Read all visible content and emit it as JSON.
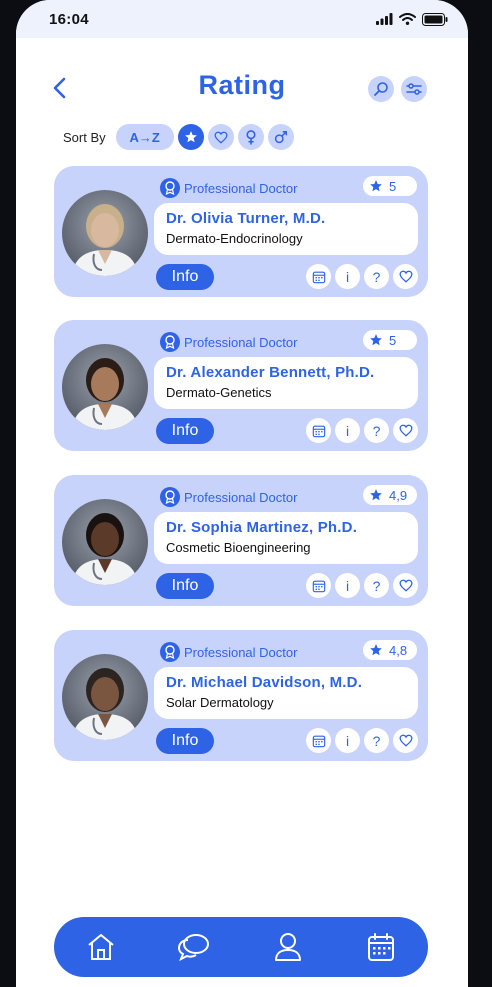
{
  "status": {
    "time": "16:04"
  },
  "header": {
    "title": "Rating"
  },
  "sort": {
    "label": "Sort By",
    "options": [
      {
        "label": "A→Z",
        "icon": "alphabetical-icon"
      },
      {
        "label": "",
        "icon": "star-icon",
        "active": true
      },
      {
        "label": "",
        "icon": "heart-icon"
      },
      {
        "label": "",
        "icon": "female-icon"
      },
      {
        "label": "",
        "icon": "male-icon"
      }
    ]
  },
  "doctors": [
    {
      "badge": "Professional Doctor",
      "rating": "5",
      "name": "Dr. Olivia Turner, M.D.",
      "specialty": "Dermato-Endocrinology",
      "info_label": "Info"
    },
    {
      "badge": "Professional Doctor",
      "rating": "5",
      "name": "Dr. Alexander Bennett, Ph.D.",
      "specialty": "Dermato-Genetics",
      "info_label": "Info"
    },
    {
      "badge": "Professional Doctor",
      "rating": "4,9",
      "name": "Dr. Sophia Martinez, Ph.D.",
      "specialty": "Cosmetic Bioengineering",
      "info_label": "Info"
    },
    {
      "badge": "Professional Doctor",
      "rating": "4,8",
      "name": "Dr. Michael Davidson, M.D.",
      "specialty": "Solar Dermatology",
      "info_label": "Info"
    }
  ],
  "actions": {
    "info_glyph": "i",
    "question_glyph": "?"
  },
  "colors": {
    "accent": "#2f63e6",
    "card_bg": "#c8d3fb",
    "status_bg": "#eef2fd"
  },
  "bottom_nav": [
    "home-icon",
    "chat-icon",
    "profile-icon",
    "calendar-icon"
  ]
}
